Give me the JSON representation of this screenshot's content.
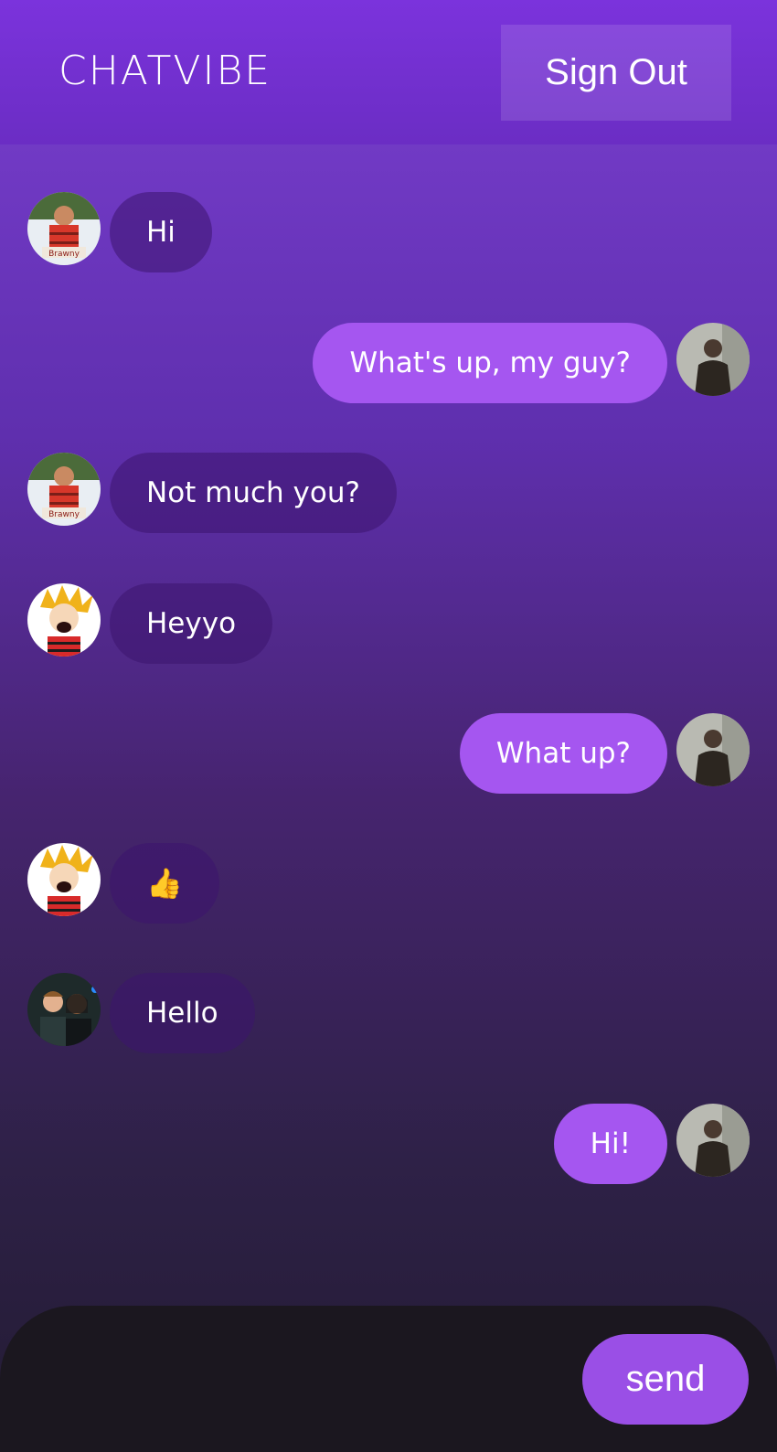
{
  "header": {
    "logo": "CHATVIBE",
    "signout_label": "Sign Out"
  },
  "messages": [
    {
      "direction": "in",
      "avatar": "lumberjack-avatar",
      "text": "Hi"
    },
    {
      "direction": "out",
      "avatar": "self-avatar",
      "text": "What's up, my guy?"
    },
    {
      "direction": "in",
      "avatar": "lumberjack-avatar",
      "text": "Not much you?"
    },
    {
      "direction": "in",
      "avatar": "cartoon-boy-avatar",
      "text": "Heyyo"
    },
    {
      "direction": "out",
      "avatar": "self-avatar",
      "text": "What up?"
    },
    {
      "direction": "in",
      "avatar": "cartoon-boy-avatar",
      "text": "👍"
    },
    {
      "direction": "in",
      "avatar": "couple-avatar",
      "text": "Hello"
    },
    {
      "direction": "out",
      "avatar": "self-avatar",
      "text": "Hi!"
    }
  ],
  "composer": {
    "input_value": "",
    "input_placeholder": "",
    "send_label": "send"
  },
  "colors": {
    "header": "#7b33dc",
    "outgoing_bubble": "#a556f0",
    "incoming_bubble": "#3c146e",
    "send_button": "#9a4fe6",
    "composer_bg": "#1b171f"
  }
}
